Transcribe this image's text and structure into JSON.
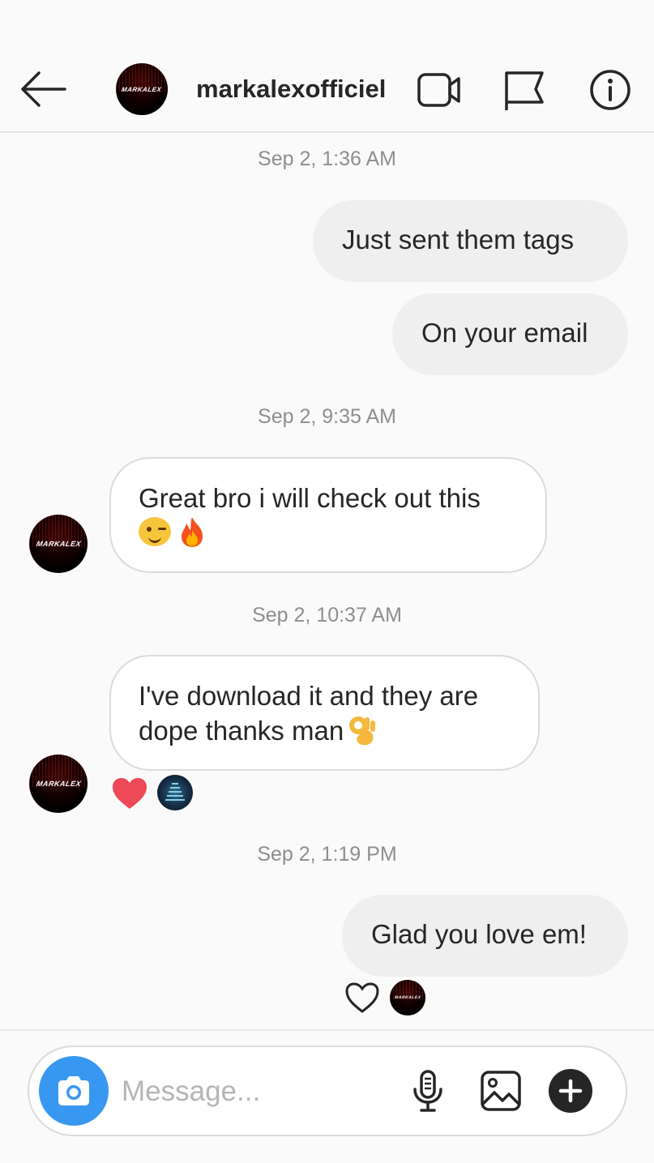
{
  "header": {
    "username": "markalexofficiel",
    "avatar_text": "MARKALEX"
  },
  "conversation": {
    "timestamps": [
      "Sep 2, 1:36 AM",
      "Sep 2, 9:35 AM",
      "Sep 2, 10:37 AM",
      "Sep 2, 1:19 PM"
    ],
    "messages": [
      {
        "direction": "outgoing",
        "text": "Just sent them tags"
      },
      {
        "direction": "outgoing",
        "text": "On your email"
      },
      {
        "direction": "incoming",
        "text": "Great bro i will check out this",
        "emojis": [
          "winking-face",
          "fire"
        ]
      },
      {
        "direction": "incoming",
        "line1": "I've download it and they are",
        "line2": "dope thanks man",
        "emojis": [
          "ok-hand"
        ],
        "reaction": "red-heart"
      },
      {
        "direction": "outgoing",
        "text": "Glad you love em!",
        "reaction": "heart-outline"
      }
    ]
  },
  "composer": {
    "placeholder": "Message..."
  },
  "colors": {
    "accent_blue": "#3897f0",
    "reaction_red": "#ed4956",
    "outgoing_bubble": "#efefef",
    "timestamp_gray": "#8e8e8e"
  },
  "icons": [
    "back-arrow-icon",
    "video-call-icon",
    "flag-icon",
    "info-icon",
    "camera-icon",
    "microphone-icon",
    "gallery-icon",
    "plus-icon",
    "heart-icon",
    "wink-emoji-icon",
    "fire-emoji-icon",
    "ok-hand-emoji-icon"
  ]
}
